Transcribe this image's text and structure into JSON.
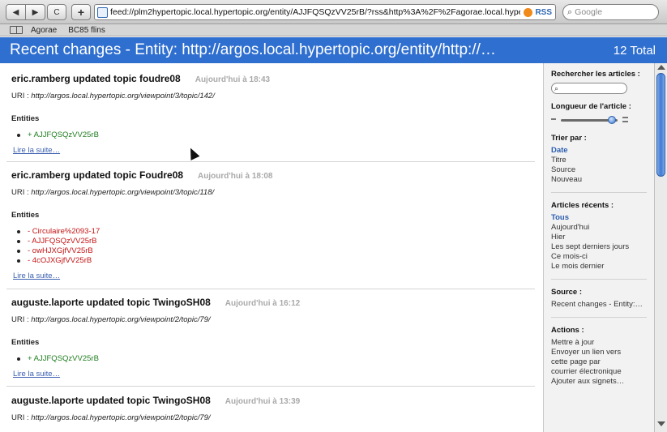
{
  "toolbar": {
    "back": "◀",
    "forward": "▶",
    "reload": "C",
    "add": "+",
    "url": "feed://plm2hypertopic.local.hypertopic.org/entity/AJJFQSQzVV25rB/?rss&http%3A%2F%2Fagorae.local.hyper",
    "rss_label": "RSS",
    "search_placeholder": "Google"
  },
  "bookmarks": [
    "Agorae",
    "BC85 flins"
  ],
  "header": {
    "title": "Recent changes - Entity: http://argos.local.hypertopic.org/entity/http://…",
    "total": "12 Total"
  },
  "articles": [
    {
      "title": "eric.ramberg updated topic foudre08",
      "time": "Aujourd'hui à 18:43",
      "uri_label": "URI : ",
      "uri": "http://argos.local.hypertopic.org/viewpoint/3/topic/142/",
      "entities_title": "Entities",
      "entities": [
        "+ AJJFQSQzVV25rB"
      ],
      "read_more": "Lire la suite…"
    },
    {
      "title": "eric.ramberg updated topic Foudre08",
      "time": "Aujourd'hui à 18:08",
      "uri_label": "URI : ",
      "uri": "http://argos.local.hypertopic.org/viewpoint/3/topic/118/",
      "entities_title": "Entities",
      "entities": [
        "- Circulaire%2093-17",
        "- AJJFQSQzVV25rB",
        "- owHJXGjfVV25rB",
        "- 4cOJXGjfVV25rB"
      ],
      "read_more": "Lire la suite…"
    },
    {
      "title": "auguste.laporte updated topic TwingoSH08",
      "time": "Aujourd'hui à 16:12",
      "uri_label": "URI : ",
      "uri": "http://argos.local.hypertopic.org/viewpoint/2/topic/79/",
      "entities_title": "Entities",
      "entities": [
        "+ AJJFQSQzVV25rB"
      ],
      "read_more": "Lire la suite…"
    },
    {
      "title": "auguste.laporte updated topic TwingoSH08",
      "time": "Aujourd'hui à 13:39",
      "uri_label": "URI : ",
      "uri": "http://argos.local.hypertopic.org/viewpoint/2/topic/79/"
    }
  ],
  "sidebar": {
    "search_title": "Rechercher les articles :",
    "length_title": "Longueur de l'article :",
    "length_level": 0.9,
    "sort_title": "Trier par :",
    "sort_items": [
      "Date",
      "Titre",
      "Source",
      "Nouveau"
    ],
    "recent_title": "Articles récents :",
    "recent_items": [
      "Tous",
      "Aujourd'hui",
      "Hier",
      "Les sept derniers jours",
      "Ce mois-ci",
      "Le mois dernier"
    ],
    "source_title": "Source :",
    "source_value": "Recent changes - Entity:…",
    "actions_title": "Actions :",
    "actions": [
      "Mettre à jour",
      "Envoyer un lien vers",
      "cette page par",
      "courrier électronique",
      "Ajouter aux signets…"
    ]
  },
  "colors": {
    "header_bg": "#2f6fd0",
    "added_entity": "#1f7d1f",
    "removed_entity": "#c41414",
    "link": "#3a5fb0"
  }
}
